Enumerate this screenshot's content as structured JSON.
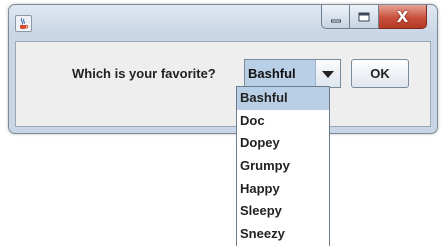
{
  "window": {
    "app_icon": "java-cup-icon",
    "controls": {
      "minimize": "minimize-icon",
      "maximize": "maximize-icon",
      "close": "close-icon",
      "close_glyph": "X"
    }
  },
  "dialog": {
    "prompt": "Which is your favorite?",
    "combo": {
      "selected": "Bashful",
      "arrow_icon": "chevron-down-icon"
    },
    "ok_label": "OK"
  },
  "dropdown": {
    "items": [
      "Bashful",
      "Doc",
      "Dopey",
      "Grumpy",
      "Happy",
      "Sleepy",
      "Sneezy"
    ],
    "highlighted": "Bashful"
  },
  "colors": {
    "selection": "#b8cfe5",
    "close_button": "#c9503c",
    "title_bar": "#c9d6e6"
  }
}
